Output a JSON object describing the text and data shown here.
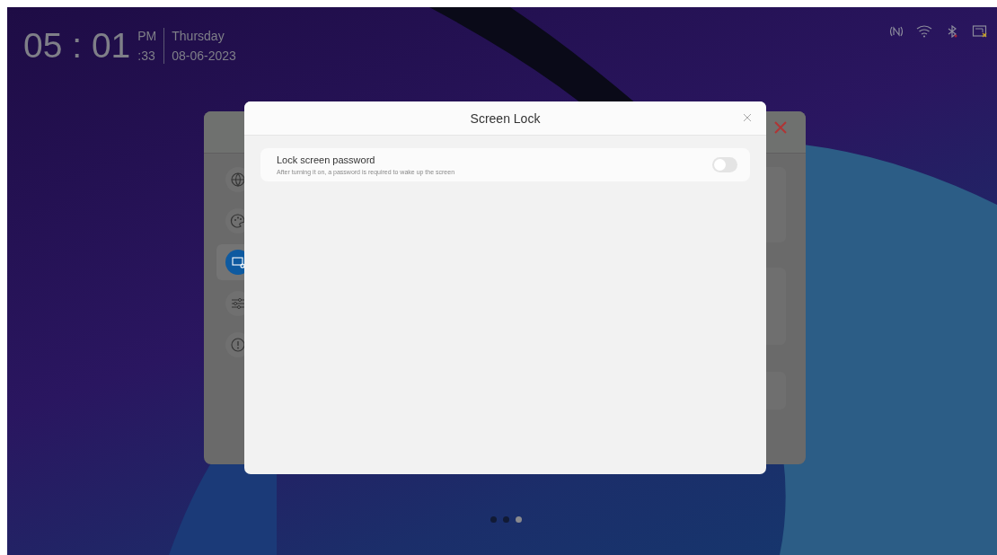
{
  "clock": {
    "time": "05 : 01",
    "meridiem": "PM",
    "seconds": ":33",
    "weekday": "Thursday",
    "date": "08-06-2023"
  },
  "background_settings": {
    "sidebar": [
      {
        "selected": false
      },
      {
        "selected": false
      },
      {
        "selected": true
      },
      {
        "selected": false
      },
      {
        "selected": false
      }
    ]
  },
  "dialog": {
    "title": "Screen Lock",
    "items": [
      {
        "title": "Lock screen password",
        "description": "After turning it on, a password is required to wake up the screen",
        "on": false
      }
    ]
  },
  "page_dots": [
    {
      "selected": false
    },
    {
      "selected": false
    },
    {
      "selected": true
    }
  ]
}
